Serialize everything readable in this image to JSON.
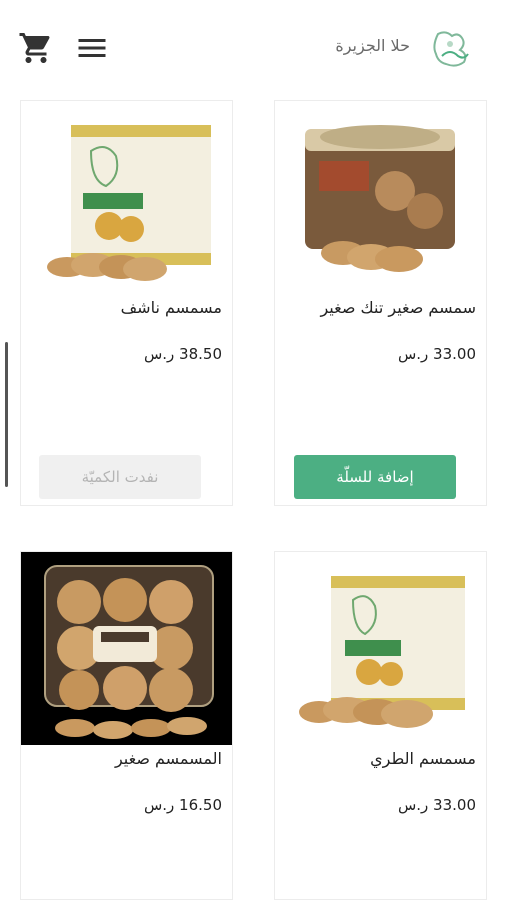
{
  "header": {
    "brand_name": "حلا الجزيرة",
    "cart_icon": "shopping-cart-icon",
    "menu_icon": "hamburger-menu-icon",
    "logo_icon": "brand-logo-icon"
  },
  "colors": {
    "accent": "#4caf83",
    "disabled_bg": "#f0f0f0",
    "disabled_text": "#b4b4b4"
  },
  "products": [
    {
      "name": "سمسم صغير تنك صغير",
      "price": "33.00 ر.س",
      "button": "إضافة للسلّة",
      "in_stock": true
    },
    {
      "name": "مسمسم ناشف",
      "price": "38.50 ر.س",
      "button": "نفدت الكميّة",
      "in_stock": false
    },
    {
      "name": "مسمسم الطري",
      "price": "33.00 ر.س"
    },
    {
      "name": "المسمسم صغير",
      "price": "16.50 ر.س"
    }
  ]
}
